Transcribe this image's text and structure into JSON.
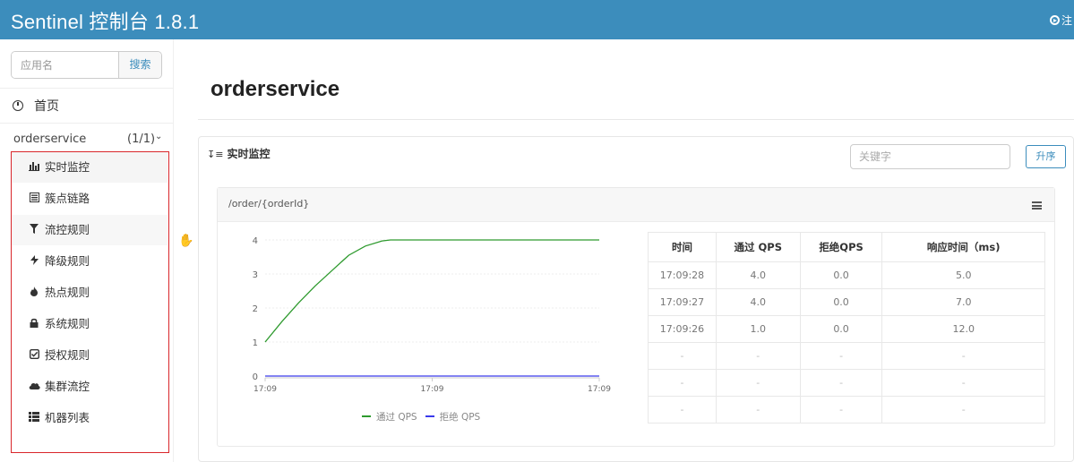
{
  "header": {
    "brand": "Sentinel 控制台 1.8.1",
    "logout_label": "注",
    "color": "#3c8dbc"
  },
  "sidebar": {
    "search": {
      "placeholder": "应用名",
      "button": "搜索"
    },
    "home": {
      "label": "首页",
      "icon": "clock-icon"
    },
    "app": {
      "name": "orderservice",
      "count": "(1/1)"
    },
    "menu": [
      {
        "label": "实时监控",
        "icon": "bar-chart-icon"
      },
      {
        "label": "簇点链路",
        "icon": "list-alt-icon"
      },
      {
        "label": "流控规则",
        "icon": "filter-icon"
      },
      {
        "label": "降级规则",
        "icon": "flash-icon"
      },
      {
        "label": "热点规则",
        "icon": "fire-icon"
      },
      {
        "label": "系统规则",
        "icon": "lock-icon"
      },
      {
        "label": "授权规则",
        "icon": "check-icon"
      },
      {
        "label": "集群流控",
        "icon": "cloud-icon"
      },
      {
        "label": "机器列表",
        "icon": "th-list-icon"
      }
    ]
  },
  "main": {
    "title": "orderservice",
    "panel": {
      "title": "实时监控",
      "keyword_placeholder": "关键字",
      "sort_button": "升序"
    },
    "card": {
      "resource": "/order/{orderId}",
      "table": {
        "headers": [
          "时间",
          "通过 QPS",
          "拒绝QPS",
          "响应时间（ms)"
        ],
        "rows": [
          [
            "17:09:28",
            "4.0",
            "0.0",
            "5.0"
          ],
          [
            "17:09:27",
            "4.0",
            "0.0",
            "7.0"
          ],
          [
            "17:09:26",
            "1.0",
            "0.0",
            "12.0"
          ],
          [
            "-",
            "-",
            "-",
            "-"
          ],
          [
            "-",
            "-",
            "-",
            "-"
          ],
          [
            "-",
            "-",
            "-",
            "-"
          ]
        ]
      }
    }
  },
  "chart_data": {
    "type": "line",
    "x": [
      "17:09",
      "17:09",
      "17:09"
    ],
    "ylim": [
      0,
      4
    ],
    "yticks": [
      0,
      1,
      2,
      3,
      4
    ],
    "grid": true,
    "legend": "bottom",
    "series": [
      {
        "name": "通过 QPS",
        "color": "#2e9a2e",
        "points": [
          [
            0,
            1
          ],
          [
            0.1,
            1.6
          ],
          [
            0.2,
            2.15
          ],
          [
            0.3,
            2.65
          ],
          [
            0.4,
            3.1
          ],
          [
            0.5,
            3.55
          ],
          [
            0.6,
            3.82
          ],
          [
            0.7,
            3.97
          ],
          [
            0.75,
            4
          ],
          [
            1,
            4
          ],
          [
            2,
            4
          ]
        ]
      },
      {
        "name": "拒绝 QPS",
        "color": "#3a3aeb",
        "points": [
          [
            0,
            0
          ],
          [
            1,
            0
          ],
          [
            2,
            0
          ]
        ]
      }
    ]
  }
}
